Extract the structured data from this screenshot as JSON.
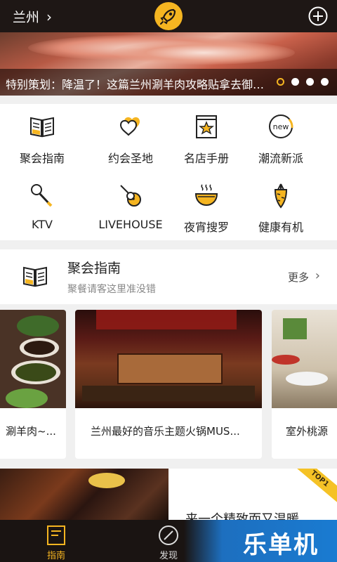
{
  "topbar": {
    "city": "兰州",
    "city_chevron": "›",
    "logo_icon": "rocket-icon",
    "add_icon": "plus-circle-icon"
  },
  "banner": {
    "caption": "特别策划：降温了！这篇兰州涮羊肉攻略贴拿去御寒…",
    "slide_count": 4,
    "active_slide": 1
  },
  "categories": [
    {
      "label": "聚会指南",
      "icon": "book-icon"
    },
    {
      "label": "约会圣地",
      "icon": "hearts-icon"
    },
    {
      "label": "名店手册",
      "icon": "star-book-icon"
    },
    {
      "label": "潮流新派",
      "icon": "new-badge-icon"
    },
    {
      "label": "KTV",
      "icon": "microphone-icon"
    },
    {
      "label": "LIVEHOUSE",
      "icon": "guitar-icon"
    },
    {
      "label": "夜宵搜罗",
      "icon": "bowl-icon"
    },
    {
      "label": "健康有机",
      "icon": "carrot-icon"
    }
  ],
  "section": {
    "title": "聚会指南",
    "subtitle": "聚餐请客这里准没错",
    "more": "更多",
    "cards": [
      {
        "text": "涮羊肉~..."
      },
      {
        "text": "兰州最好的音乐主题火锅MUS..."
      },
      {
        "text": "室外桃源"
      }
    ]
  },
  "promo": {
    "text": "来一个精致而又温暖",
    "badge": "TOP1"
  },
  "bottomnav": {
    "tabs": [
      {
        "label": "指南",
        "active": true
      },
      {
        "label": "发现",
        "active": false
      }
    ]
  },
  "watermark": "乐单机",
  "colors": {
    "accent": "#f5b521",
    "topbar": "#1e1715",
    "bottomnav": "#1a1412"
  }
}
